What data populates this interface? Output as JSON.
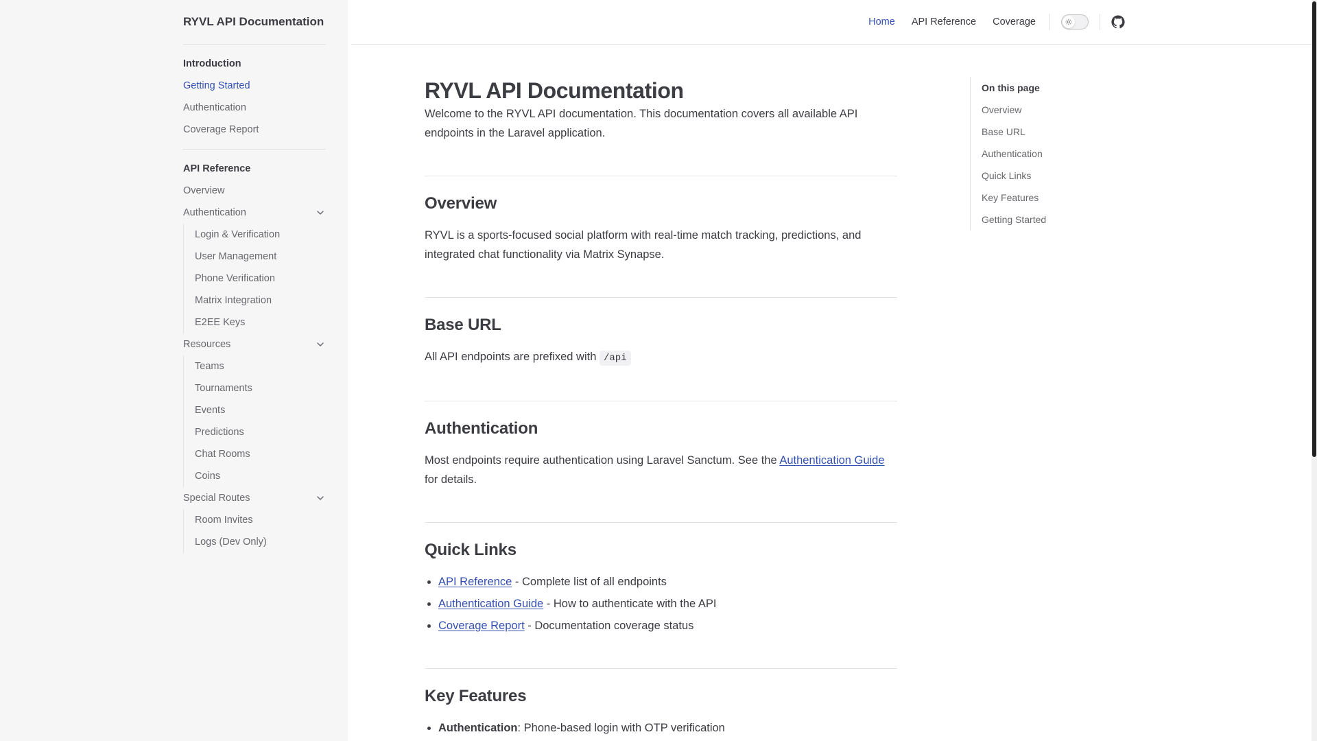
{
  "sidebar": {
    "site_title": "RYVL API Documentation",
    "groups": [
      {
        "heading": "Introduction",
        "items": [
          "Getting Started",
          "Authentication",
          "Coverage Report"
        ],
        "active_item": "Getting Started"
      },
      {
        "heading": "API Reference",
        "overview": "Overview",
        "sections": [
          {
            "label": "Authentication",
            "expanded": true,
            "children": [
              "Login & Verification",
              "User Management",
              "Phone Verification",
              "Matrix Integration",
              "E2EE Keys"
            ]
          },
          {
            "label": "Resources",
            "expanded": true,
            "children": [
              "Teams",
              "Tournaments",
              "Events",
              "Predictions",
              "Chat Rooms",
              "Coins"
            ]
          },
          {
            "label": "Special Routes",
            "expanded": true,
            "children": [
              "Room Invites",
              "Logs (Dev Only)"
            ]
          }
        ]
      }
    ]
  },
  "topnav": {
    "links": [
      "Home",
      "API Reference",
      "Coverage"
    ],
    "active": "Home",
    "theme_toggle_icon": "sun-icon",
    "github_icon": "github-icon"
  },
  "content": {
    "title": "RYVL API Documentation",
    "intro": "Welcome to the RYVL API documentation. This documentation covers all available API endpoints in the Laravel application.",
    "overview": {
      "heading": "Overview",
      "text": "RYVL is a sports-focused social platform with real-time match tracking, predictions, and integrated chat functionality via Matrix Synapse."
    },
    "base_url": {
      "heading": "Base URL",
      "text": "All API endpoints are prefixed with",
      "code": "/api"
    },
    "authentication": {
      "heading": "Authentication",
      "text_before": "Most endpoints require authentication using Laravel Sanctum. See the",
      "link": "Authentication Guide",
      "text_after": "for details."
    },
    "quick_links": {
      "heading": "Quick Links",
      "items": [
        {
          "link": "API Reference",
          "desc": " - Complete list of all endpoints"
        },
        {
          "link": "Authentication Guide",
          "desc": " - How to authenticate with the API"
        },
        {
          "link": "Coverage Report",
          "desc": " - Documentation coverage status"
        }
      ]
    },
    "key_features": {
      "heading": "Key Features",
      "items": [
        {
          "bold": "Authentication",
          "desc": ": Phone-based login with OTP verification"
        }
      ]
    }
  },
  "outline": {
    "title": "On this page",
    "items": [
      "Overview",
      "Base URL",
      "Authentication",
      "Quick Links",
      "Key Features",
      "Getting Started"
    ]
  },
  "colors": {
    "brand": "#3451b2",
    "text": "#3c3c43",
    "muted": "#67676c",
    "sidebar_bg": "#f6f6f7",
    "divider": "#e2e2e3"
  }
}
